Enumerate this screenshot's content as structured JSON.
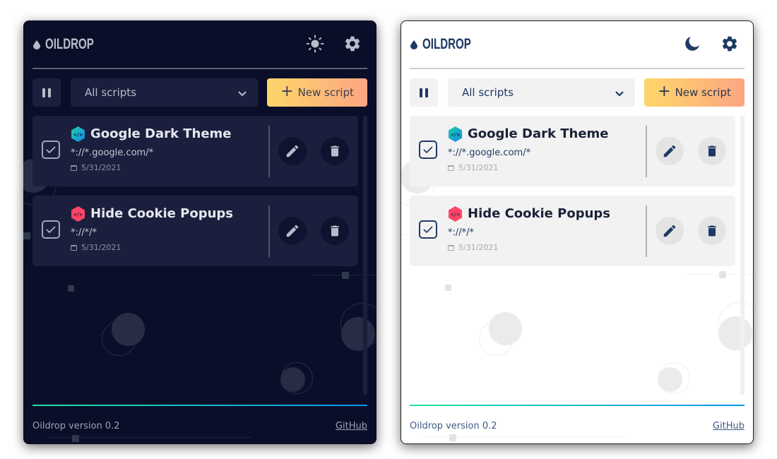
{
  "app": {
    "name": "OILDROP",
    "version_text": "Oildrop version 0.2",
    "github_label": "GitHub"
  },
  "panels": [
    {
      "theme": "dark",
      "theme_toggle_icon": "sun-icon",
      "settings_icon": "gear-icon"
    },
    {
      "theme": "light",
      "theme_toggle_icon": "moon-icon",
      "settings_icon": "gear-icon"
    }
  ],
  "toolbar": {
    "pause_icon": "pause-icon",
    "filter_selected": "All scripts",
    "new_script_label": "New script",
    "new_script_gradient": [
      "#fdd66a",
      "#fda682"
    ]
  },
  "scripts": [
    {
      "title": "Google Dark Theme",
      "match": "*://*.google.com/*",
      "date": "5/31/2021",
      "enabled": true,
      "icon": "code-hex-icon",
      "icon_color": [
        "#1fd1a9",
        "#1286e8"
      ]
    },
    {
      "title": "Hide Cookie Popups",
      "match": "*://*/*",
      "date": "5/31/2021",
      "enabled": true,
      "icon": "code-hex-icon",
      "icon_color": [
        "#ff4f70",
        "#ff3b5c"
      ]
    }
  ],
  "colors": {
    "dark_bg": "#0a0e29",
    "dark_card": "#1b1f3d",
    "light_bg": "#ffffff",
    "light_card": "#f2f2f2",
    "light_accent": "#1e3a64",
    "footer_gradient": [
      "#21e39f",
      "#0b94f0"
    ]
  }
}
